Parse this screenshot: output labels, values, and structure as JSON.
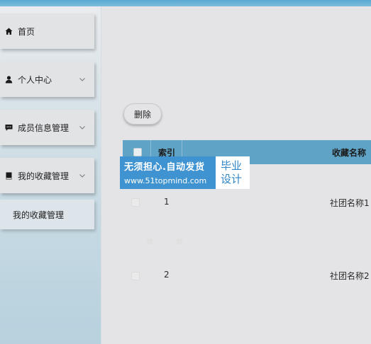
{
  "sidebar": {
    "items": [
      {
        "label": "首页",
        "icon": "home-icon",
        "expandable": false
      },
      {
        "label": "个人中心",
        "icon": "user-icon",
        "expandable": true
      },
      {
        "label": "成员信息管理",
        "icon": "chat-icon",
        "expandable": true
      },
      {
        "label": "我的收藏管理",
        "icon": "book-icon",
        "expandable": true,
        "expanded": true
      }
    ],
    "subitems": [
      {
        "label": "我的收藏管理"
      }
    ]
  },
  "toolbar": {
    "delete_label": "删除"
  },
  "table": {
    "columns": [
      "索引",
      "收藏名称"
    ],
    "rows": [
      {
        "index": "1",
        "name": "社团名称1"
      },
      {
        "index": "2",
        "name": "社团名称2"
      }
    ]
  },
  "watermark": {
    "line1": "无须担心.自动发货",
    "line2": "www.51topmind.com",
    "badge_top": "毕业",
    "badge_bottom": "设计"
  },
  "colors": {
    "accent": "#5fa3c7",
    "watermark_bg": "#3f93d1",
    "badge_text": "#2f86c8"
  }
}
